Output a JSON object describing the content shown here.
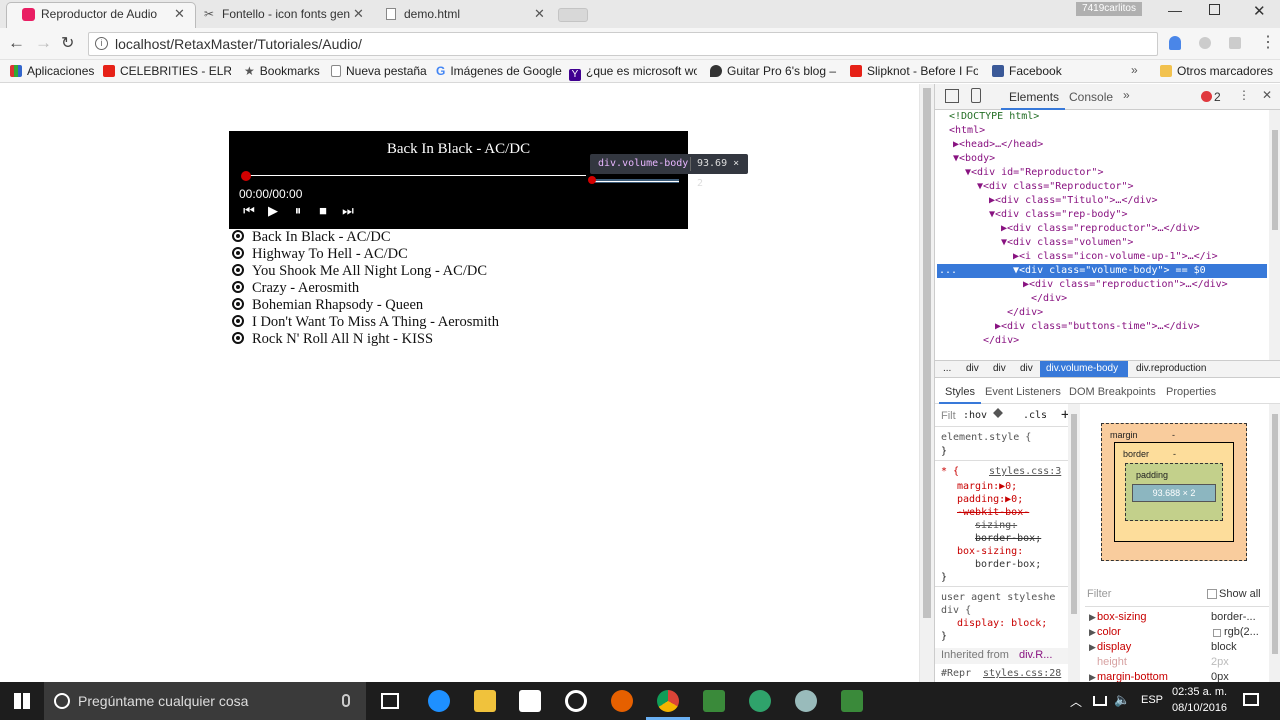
{
  "tabs": [
    {
      "label": "Reproductor de Audio",
      "active": true
    },
    {
      "label": "Fontello - icon fonts gen",
      "active": false
    },
    {
      "label": "demo.html",
      "active": false
    }
  ],
  "window": {
    "user": "7419carlitos"
  },
  "address": {
    "url": "localhost/RetaxMaster/Tutoriales/Audio/"
  },
  "bookmarks": [
    {
      "label": "Aplicaciones",
      "icon": "apps-icon",
      "color": "#d33"
    },
    {
      "label": "CELEBRITIES - ELRUBI",
      "icon": "youtube-icon",
      "color": "#e62117"
    },
    {
      "label": "Bookmarks",
      "icon": "star-icon",
      "color": "#555"
    },
    {
      "label": "Nueva pestaña",
      "icon": "page-icon",
      "color": "#888"
    },
    {
      "label": "Imágenes de Google",
      "icon": "google-icon",
      "color": "#4285f4"
    },
    {
      "label": "¿que es microsoft wo",
      "icon": "yahoo-icon",
      "color": "#400090"
    },
    {
      "label": "Guitar Pro 6's blog –",
      "icon": "guitar-pick-icon",
      "color": "#333"
    },
    {
      "label": "Slipknot - Before I Fo",
      "icon": "youtube-icon",
      "color": "#e62117"
    },
    {
      "label": "Facebook",
      "icon": "facebook-icon",
      "color": "#3b5998"
    }
  ],
  "other_bookmarks": "Otros marcadores",
  "player": {
    "title": "Back In Black - AC/DC",
    "time": "00:00/00:00",
    "controls": [
      "previous",
      "play",
      "pause",
      "stop",
      "next"
    ]
  },
  "tooltip": {
    "selector": "div.volume-body",
    "size": "93.69 × 2"
  },
  "playlist": [
    "Back In Black - AC/DC",
    "Highway To Hell - AC/DC",
    "You Shook Me All Night Long - AC/DC",
    "Crazy - Aerosmith",
    "Bohemian Rhapsody - Queen",
    "I Don't Want To Miss A Thing - Aerosmith",
    "Rock N' Roll All N ight - KISS"
  ],
  "devtools": {
    "tabs": [
      "Elements",
      "Console"
    ],
    "error_count": "2",
    "tree": [
      {
        "t": "<!DOCTYPE html>",
        "k": "doctype"
      },
      {
        "t": "<html>",
        "k": "tag"
      },
      {
        "t": "▶<head>…</head>",
        "k": "tag"
      },
      {
        "t": "▼<body>",
        "k": "tag"
      },
      {
        "t": "▼<div id=\"Reproductor\">",
        "k": "tag"
      },
      {
        "t": "▼<div class=\"Reproductor\">",
        "k": "tag"
      },
      {
        "t": "▶<div class=\"Titulo\">…</div>",
        "k": "tag"
      },
      {
        "t": "▼<div class=\"rep-body\">",
        "k": "tag"
      },
      {
        "t": "▶<div class=\"reproductor\">…</div>",
        "k": "tag"
      },
      {
        "t": "▼<div class=\"volumen\">",
        "k": "tag"
      },
      {
        "t": "▶<i class=\"icon-volume-up-1\">…</i>",
        "k": "tag"
      },
      {
        "t": "▼<div class=\"volume-body\"> == $0",
        "k": "selected"
      },
      {
        "t": "▶<div class=\"reproduction\">…</div>",
        "k": "tag"
      },
      {
        "t": "</div>",
        "k": "tag"
      },
      {
        "t": "</div>",
        "k": "tag"
      },
      {
        "t": "▶<div class=\"buttons-time\">…</div>",
        "k": "tag"
      },
      {
        "t": "</div>",
        "k": "tag"
      }
    ],
    "breadcrumbs": [
      "...",
      "div",
      "div",
      "div",
      "div.volume-body",
      "div.reproduction"
    ],
    "subtabs": [
      "Styles",
      "Event Listeners",
      "DOM Breakpoints",
      "Properties"
    ],
    "filter": "Filt",
    "hov": ":hov",
    "cls": ".cls",
    "styles": {
      "element_style": "element.style {",
      "close": "}",
      "rule_selector": "* {",
      "rule_source": "styles.css:3",
      "decls": [
        "margin:▶0;",
        "padding:▶0;",
        "-webkit-box-",
        "sizing:",
        "border-box;",
        "box-sizing:",
        "border-box;"
      ],
      "ua": "user agent styleshe",
      "ua_sel": "div {",
      "ua_decl": "display: block;",
      "inherited_label": "Inherited from",
      "inherited_from": "div.R...",
      "repr": "#Repr",
      "repr_source": "styles.css:28"
    },
    "box": {
      "margin": "margin",
      "border": "border",
      "padding": "padding",
      "content": "93.688 × 2",
      "dash": "-"
    },
    "computed_filter": "Filter",
    "show_all": "Show all",
    "computed": [
      {
        "prop": "box-sizing",
        "val": "border-..."
      },
      {
        "prop": "color",
        "val": "rgb(2..."
      },
      {
        "prop": "display",
        "val": "block"
      },
      {
        "prop": "height",
        "val": "2px"
      },
      {
        "prop": "margin-bottom",
        "val": "0px"
      }
    ]
  },
  "taskbar": {
    "search": "Pregúntame cualquier cosa",
    "lang": "ESP",
    "time": "02:35 a. m.",
    "date": "08/10/2016"
  }
}
